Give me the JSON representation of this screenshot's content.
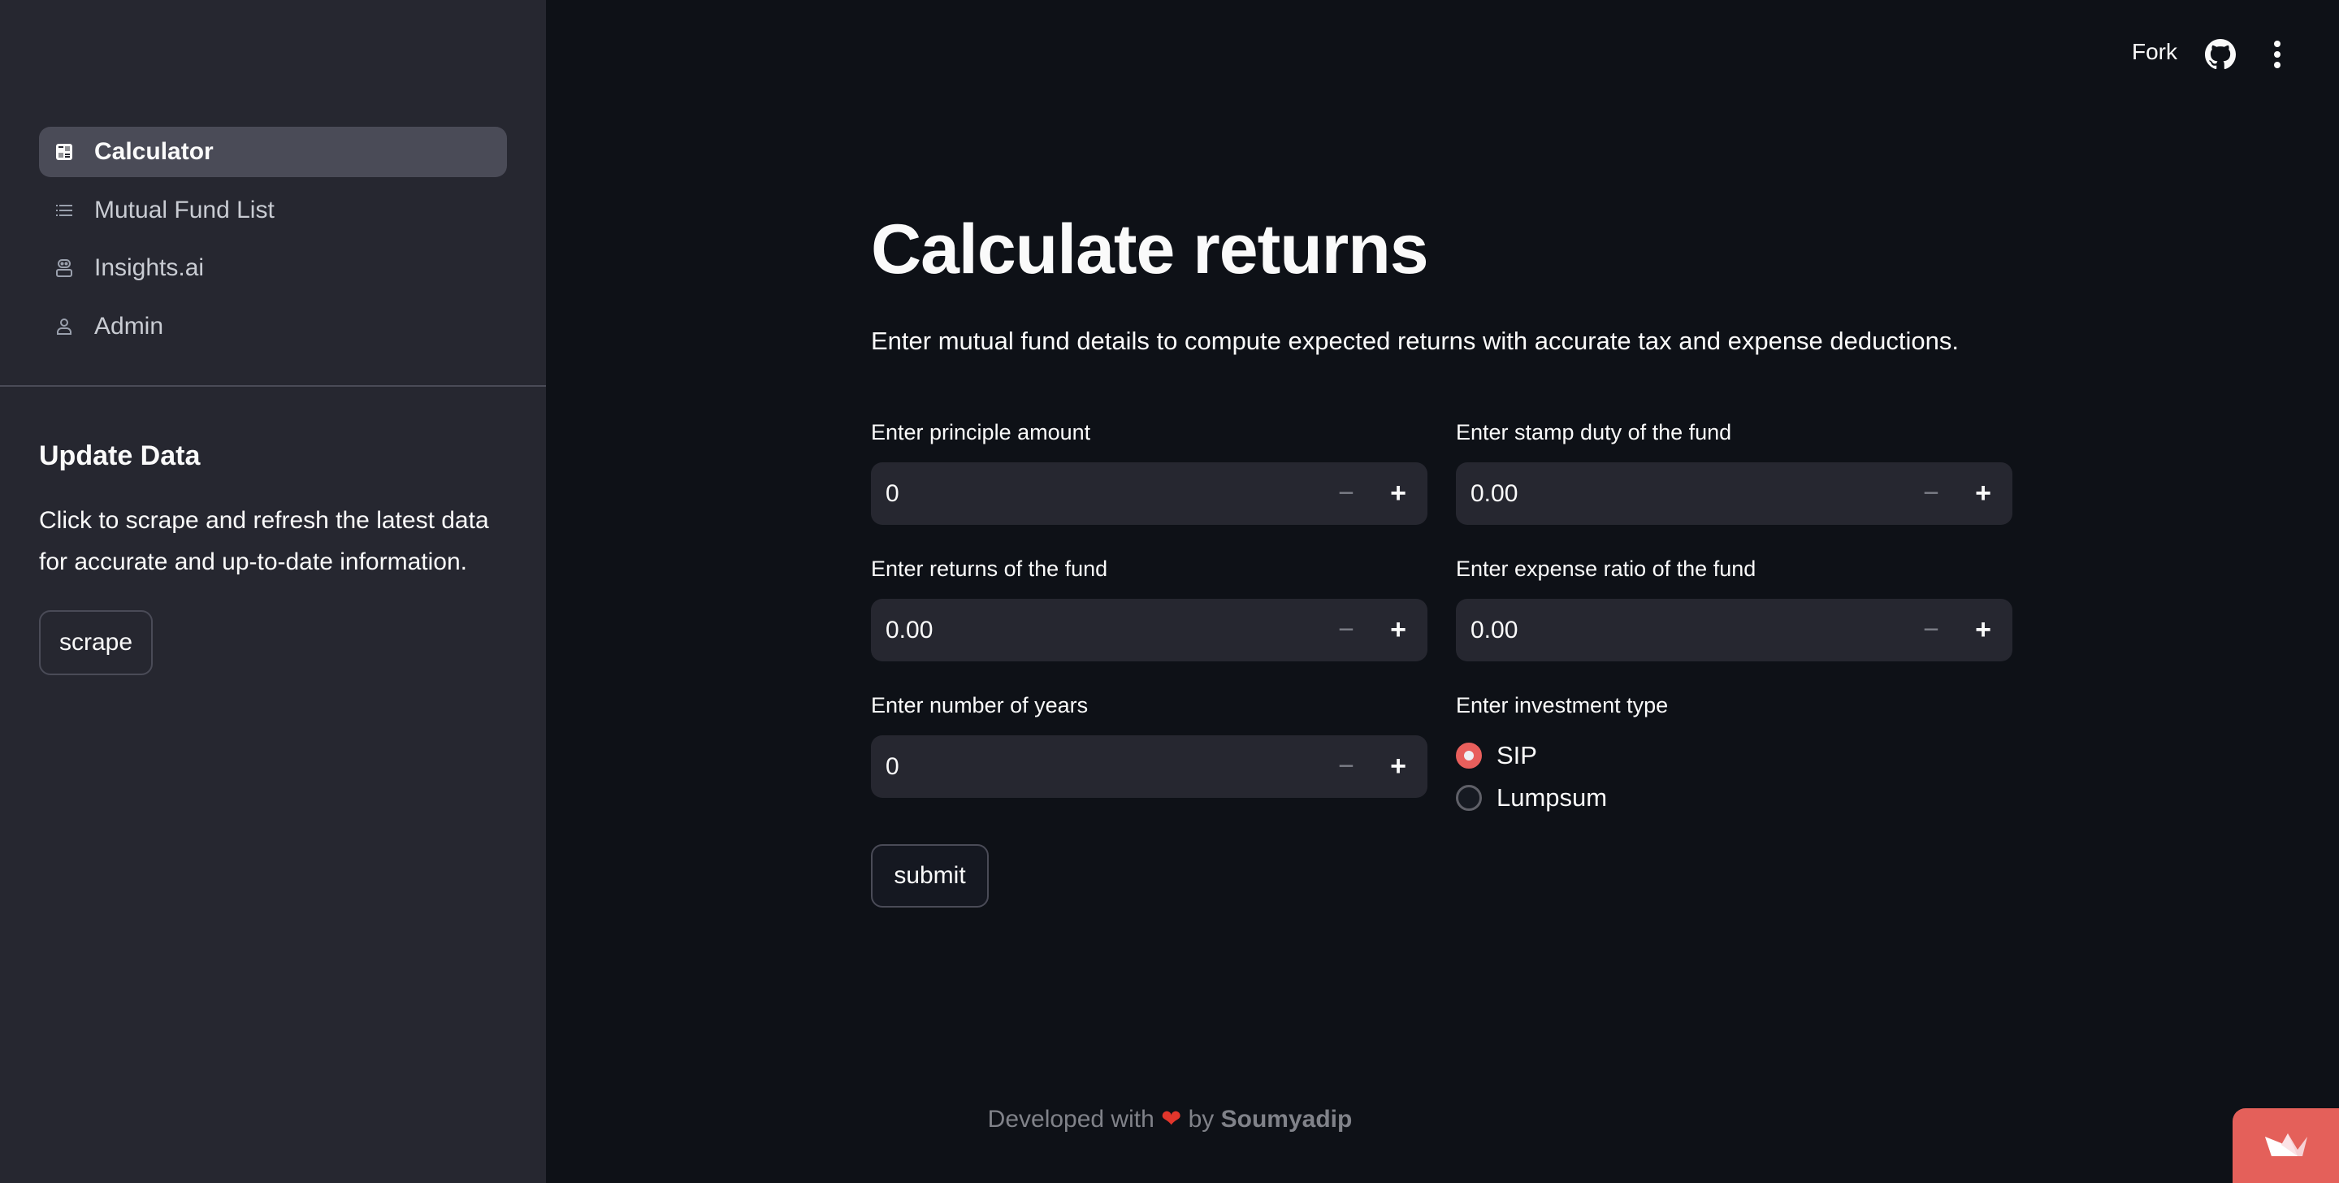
{
  "sidebar": {
    "nav": [
      {
        "label": "Calculator",
        "icon": "calculator-icon",
        "active": true
      },
      {
        "label": "Mutual Fund List",
        "icon": "list-icon",
        "active": false
      },
      {
        "label": "Insights.ai",
        "icon": "robot-icon",
        "active": false
      },
      {
        "label": "Admin",
        "icon": "person-icon",
        "active": false
      }
    ],
    "update_heading": "Update Data",
    "update_text": "Click to scrape and refresh the latest data for accurate and up-to-date information.",
    "scrape_label": "scrape"
  },
  "header": {
    "fork_label": "Fork",
    "github_icon": "github-icon",
    "menu_icon": "more-vertical-icon"
  },
  "main": {
    "title": "Calculate returns",
    "subtitle": "Enter mutual fund details to compute expected returns with accurate tax and expense deductions.",
    "fields": {
      "principle": {
        "label": "Enter principle amount",
        "value": "0"
      },
      "stamp_duty": {
        "label": "Enter stamp duty of the fund",
        "value": "0.00"
      },
      "returns": {
        "label": "Enter returns of the fund",
        "value": "0.00"
      },
      "expense_ratio": {
        "label": "Enter expense ratio of the fund",
        "value": "0.00"
      },
      "years": {
        "label": "Enter number of years",
        "value": "0"
      }
    },
    "investment_type": {
      "label": "Enter investment type",
      "options": [
        "SIP",
        "Lumpsum"
      ],
      "selected": "SIP"
    },
    "submit_label": "submit",
    "stepper": {
      "minus": "−",
      "plus": "+"
    }
  },
  "footer": {
    "prefix": "Developed with",
    "heart": "❤",
    "by": "by",
    "author": "Soumyadip"
  },
  "colors": {
    "accent": "#e85f5c",
    "sidebar_bg": "#262730",
    "main_bg": "#0e1117"
  }
}
